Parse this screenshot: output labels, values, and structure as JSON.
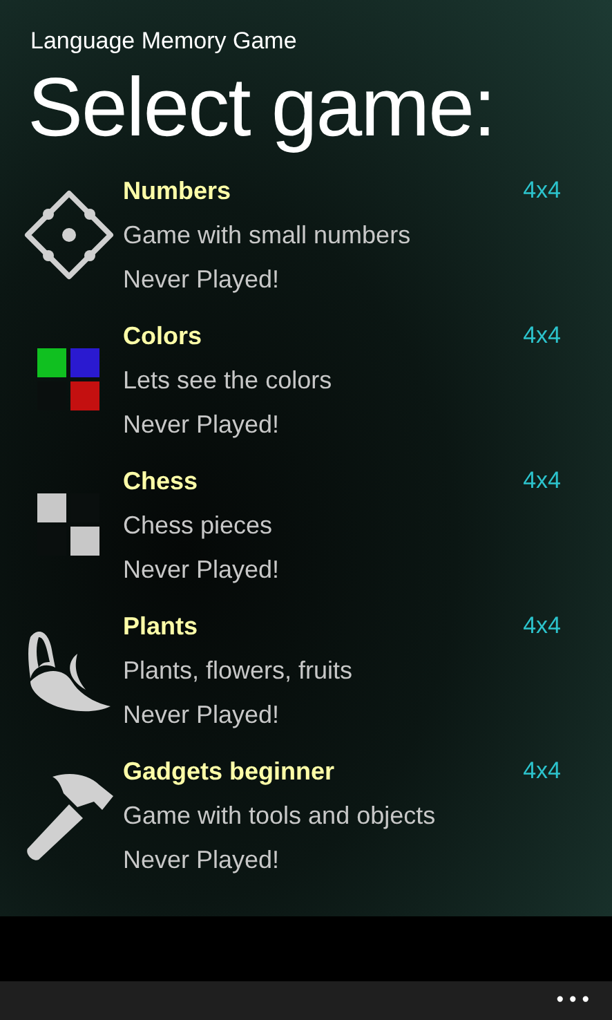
{
  "app_title": "Language Memory Game",
  "page_title": "Select game:",
  "games": [
    {
      "kind": "dice",
      "title": "Numbers",
      "description": "Game with small numbers",
      "status": "Never Played!",
      "size": "4x4"
    },
    {
      "kind": "colors",
      "title": "Colors",
      "description": "Lets see the colors",
      "status": "Never Played!",
      "size": "4x4"
    },
    {
      "kind": "chess",
      "title": "Chess",
      "description": "Chess pieces",
      "status": "Never Played!",
      "size": "4x4"
    },
    {
      "kind": "banana",
      "title": "Plants",
      "description": "Plants, flowers, fruits",
      "status": "Never Played!",
      "size": "4x4"
    },
    {
      "kind": "hammer",
      "title": "Gadgets beginner",
      "description": "Game with tools and objects",
      "status": "Never Played!",
      "size": "4x4"
    }
  ],
  "app_bar": {
    "more": "•••"
  }
}
